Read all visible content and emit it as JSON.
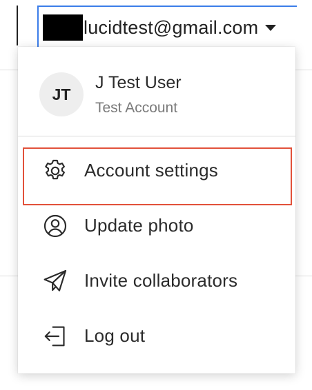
{
  "account_trigger": {
    "email": "lucidtest@gmail.com",
    "icon": "caret-down-icon",
    "redacted": true
  },
  "menu": {
    "user": {
      "initials": "JT",
      "name": "J Test User",
      "subtitle": "Test Account"
    },
    "items": [
      {
        "label": "Account settings",
        "icon": "gear-icon",
        "highlighted": true
      },
      {
        "label": "Update photo",
        "icon": "user-circle-icon",
        "highlighted": false
      },
      {
        "label": "Invite collaborators",
        "icon": "paper-plane-icon",
        "highlighted": false
      },
      {
        "label": "Log out",
        "icon": "log-out-icon",
        "highlighted": false
      }
    ]
  },
  "colors": {
    "focus_border": "#3b7de9",
    "highlight_border": "#e2513a",
    "avatar_bg": "#eeeeee",
    "text_primary": "#2b2b2b",
    "text_secondary": "#7a7a7a"
  }
}
